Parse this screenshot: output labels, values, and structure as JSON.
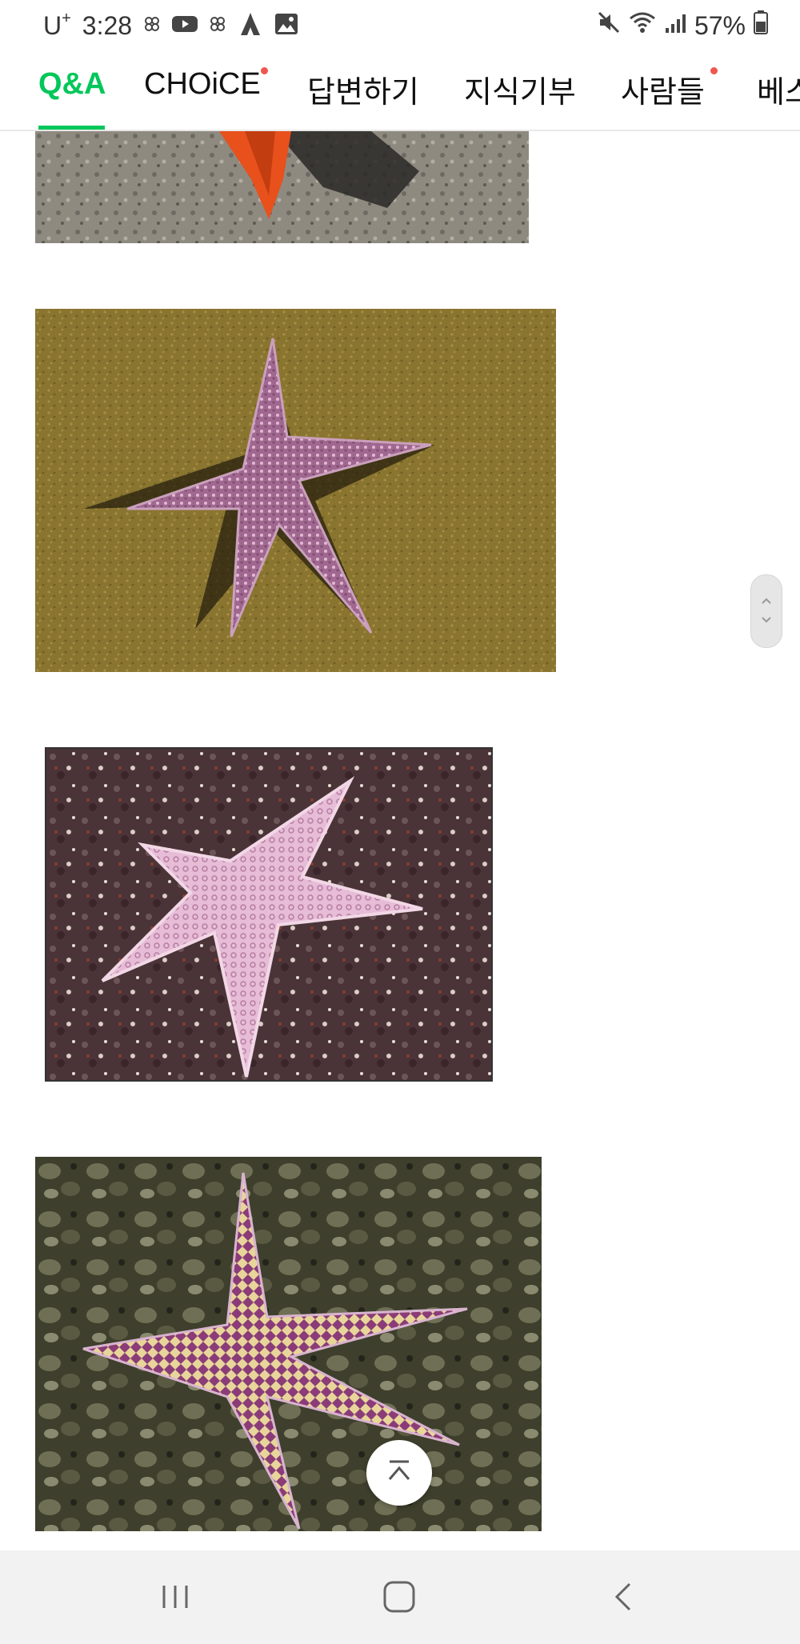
{
  "status_bar": {
    "carrier": "U",
    "carrier_sup": "+",
    "time": "3:28",
    "battery": "57%",
    "icons": [
      "chat-icon",
      "youtube-icon",
      "chat-icon",
      "game-icon",
      "gallery-icon",
      "mute-icon",
      "wifi-icon",
      "signal-icon",
      "battery-icon"
    ]
  },
  "tabs": [
    {
      "label": "Q&A",
      "active": true
    },
    {
      "label": "CHOiCE",
      "badge": true
    },
    {
      "label": "답변하기"
    },
    {
      "label": "지식기부"
    },
    {
      "label": "사람들",
      "badge": true
    },
    {
      "label": "베스"
    }
  ],
  "colors": {
    "accent": "#03c75a",
    "badge": "#f05650",
    "nav_bg": "#f2f2f2"
  },
  "content": {
    "images": [
      "starfish-photo-orange-partial",
      "starfish-photo-purple-sand",
      "starfish-photo-pink-rock",
      "starfish-photo-purple-yellow"
    ]
  },
  "nav": {
    "buttons": [
      "recent-apps-icon",
      "home-icon",
      "back-icon"
    ]
  }
}
